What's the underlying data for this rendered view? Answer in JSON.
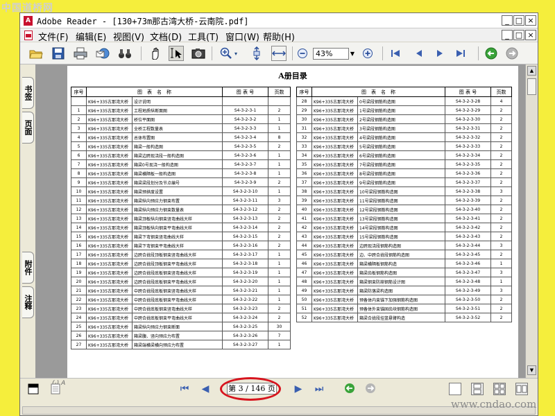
{
  "watermark": {
    "logo": "中国道桥网",
    "url": "www.cndao.com"
  },
  "window": {
    "title": "Adobe Reader - [130+73m那古湾大桥-云南院.pdf]",
    "app_icon": "adobe-reader-icon",
    "min": "_",
    "max": "□",
    "close": "×",
    "doc_min": "_",
    "doc_max": "□",
    "doc_close": "×"
  },
  "menu": [
    {
      "label": "文件(F)"
    },
    {
      "label": "编辑(E)"
    },
    {
      "label": "视图(V)"
    },
    {
      "label": "文档(D)"
    },
    {
      "label": "工具(T)"
    },
    {
      "label": "窗口(W)"
    },
    {
      "label": "帮助(H)"
    }
  ],
  "toolbar": {
    "zoom": "43%",
    "icons": [
      "open-folder-icon",
      "save-icon",
      "print-icon",
      "email-icon",
      "search-binoculars-icon",
      "hand-tool-icon",
      "select-text-icon",
      "snapshot-icon",
      "zoom-in-tool-icon",
      "fit-page-icon",
      "fit-width-icon",
      "zoom-out-icon",
      "zoom-in-icon",
      "first-page-icon",
      "prev-page-icon",
      "next-page-icon",
      "last-page-icon",
      "go-back-icon",
      "go-forward-icon"
    ]
  },
  "sidebar": {
    "tabs": [
      "书签",
      "页面",
      "附件",
      "注释"
    ]
  },
  "doc": {
    "title": "A册目录",
    "handnote": "(-) A",
    "headers": {
      "seq": "序号",
      "name": "图　表　名　称",
      "number": "图 表 号",
      "pages": "页数"
    },
    "left_rows": [
      [
        "",
        "K96+335古那湾大桥",
        "设计说明",
        "",
        ""
      ],
      [
        "1",
        "K96+335古那湾大桥",
        "工程地质纵断面图",
        "S4-3-2-3-1",
        "2"
      ],
      [
        "2",
        "K96+335古那湾大桥",
        "桥位平面图",
        "S4-3-2-3-2",
        "1"
      ],
      [
        "3",
        "K96+335古那湾大桥",
        "全桥工程数量表",
        "S4-3-2-3-3",
        "1"
      ],
      [
        "4",
        "K96+335古那湾大桥",
        "总体布置图",
        "S4-3-2-3-4",
        "8"
      ],
      [
        "5",
        "K96+335古那湾大桥",
        "箱梁一般构造图",
        "S4-3-2-3-5",
        "2"
      ],
      [
        "6",
        "K96+335古那湾大桥",
        "箱梁边跨现浇段一般构造图",
        "S4-3-2-3-6",
        "1"
      ],
      [
        "7",
        "K96+335古那湾大桥",
        "箱梁0号现浇一般构造图",
        "S4-3-2-3-7",
        "1"
      ],
      [
        "8",
        "K96+335古那湾大桥",
        "箱梁横隔板一般构造图",
        "S4-3-2-3-8",
        "1"
      ],
      [
        "9",
        "K96+335古那湾大桥",
        "箱梁梁段划分及节点编号",
        "S4-3-2-3-9",
        "2"
      ],
      [
        "10",
        "K96+335古那湾大桥",
        "箱梁预拱度设置",
        "S4-3-2-3-10",
        "1"
      ],
      [
        "11",
        "K96+335古那湾大桥",
        "箱梁纵向预应力钢束布置",
        "S4-3-2-3-11",
        "3"
      ],
      [
        "12",
        "K96+335古那湾大桥",
        "箱梁纵向预应力钢束数量表",
        "S4-3-2-3-12",
        "2"
      ],
      [
        "13",
        "K96+335古那湾大桥",
        "箱梁顶板纵向钢束竖弯曲线大样",
        "S4-3-2-3-13",
        "2"
      ],
      [
        "14",
        "K96+335古那湾大桥",
        "箱梁顶板纵向钢束平弯曲线大样",
        "S4-3-2-3-14",
        "2"
      ],
      [
        "15",
        "K96+335古那湾大桥",
        "箱梁下弯钢束竖弯曲线大样",
        "S4-3-2-3-15",
        "2"
      ],
      [
        "16",
        "K96+335古那湾大桥",
        "箱梁下弯钢束平弯曲线大样",
        "S4-3-2-3-16",
        "2"
      ],
      [
        "17",
        "K96+335古那湾大桥",
        "边跨合拢段顶板钢束竖弯曲线大样",
        "S4-3-2-3-17",
        "1"
      ],
      [
        "18",
        "K96+335古那湾大桥",
        "边跨合拢段顶板钢束平弯曲线大样",
        "S4-3-2-3-18",
        "1"
      ],
      [
        "19",
        "K96+335古那湾大桥",
        "边跨合拢段底板钢束竖弯曲线大样",
        "S4-3-2-3-19",
        "1"
      ],
      [
        "20",
        "K96+335古那湾大桥",
        "边跨合拢段底板钢束平弯曲线大样",
        "S4-3-2-3-20",
        "1"
      ],
      [
        "21",
        "K96+335古那湾大桥",
        "中跨合拢段底板钢束竖弯曲线大样",
        "S4-3-2-3-21",
        "1"
      ],
      [
        "22",
        "K96+335古那湾大桥",
        "中跨合拢段底板钢束平弯曲线大样",
        "S4-3-2-3-22",
        "1"
      ],
      [
        "23",
        "K96+335古那湾大桥",
        "中跨合拢底板钢束竖弯曲线大样",
        "S4-3-2-3-23",
        "2"
      ],
      [
        "24",
        "K96+335古那湾大桥",
        "中跨合拢底板钢束平弯曲线大样",
        "S4-3-2-3-24",
        "2"
      ],
      [
        "25",
        "K96+335古那湾大桥",
        "箱梁纵向预应力钢束断面",
        "S4-3-2-3-25",
        "30"
      ],
      [
        "26",
        "K96+335古那湾大桥",
        "箱梁腹、竖向预应力布置",
        "S4-3-2-3-26",
        "7"
      ],
      [
        "27",
        "K96+335古那湾大桥",
        "箱梁端横梁横向预应力布置",
        "S4-3-2-3-27",
        "1"
      ]
    ],
    "right_rows": [
      [
        "28",
        "K96+335古那湾大桥",
        "0号梁段钢筋构造图",
        "S4-3-2-3-28",
        "4"
      ],
      [
        "29",
        "K96+335古那湾大桥",
        "1号梁段钢筋构造图",
        "S4-3-2-3-29",
        "2"
      ],
      [
        "30",
        "K96+335古那湾大桥",
        "2号梁段钢筋构造图",
        "S4-3-2-3-30",
        "2"
      ],
      [
        "31",
        "K96+335古那湾大桥",
        "3号梁段钢筋构造图",
        "S4-3-2-3-31",
        "2"
      ],
      [
        "32",
        "K96+335古那湾大桥",
        "4号梁段钢筋构造图",
        "S4-3-2-3-32",
        "2"
      ],
      [
        "33",
        "K96+335古那湾大桥",
        "5号梁段钢筋构造图",
        "S4-3-2-3-33",
        "2"
      ],
      [
        "34",
        "K96+335古那湾大桥",
        "6号梁段钢筋构造图",
        "S4-3-2-3-34",
        "2"
      ],
      [
        "35",
        "K96+335古那湾大桥",
        "7号梁段钢筋构造图",
        "S4-3-2-3-35",
        "2"
      ],
      [
        "36",
        "K96+335古那湾大桥",
        "8号梁段钢筋构造图",
        "S4-3-2-3-36",
        "2"
      ],
      [
        "37",
        "K96+335古那湾大桥",
        "9号梁段钢筋构造图",
        "S4-3-2-3-37",
        "2"
      ],
      [
        "38",
        "K96+335古那湾大桥",
        "10号梁段钢筋构造图",
        "S4-3-2-3-38",
        "3"
      ],
      [
        "39",
        "K96+335古那湾大桥",
        "11号梁段钢筋构造图",
        "S4-3-2-3-39",
        "2"
      ],
      [
        "40",
        "K96+335古那湾大桥",
        "12号梁段钢筋构造图",
        "S4-3-2-3-40",
        "2"
      ],
      [
        "41",
        "K96+335古那湾大桥",
        "13号梁段钢筋构造图",
        "S4-3-2-3-41",
        "2"
      ],
      [
        "42",
        "K96+335古那湾大桥",
        "14号梁段钢筋构造图",
        "S4-3-2-3-42",
        "2"
      ],
      [
        "43",
        "K96+335古那湾大桥",
        "15号梁段钢筋构造图",
        "S4-3-2-3-43",
        "2"
      ],
      [
        "44",
        "K96+335古那湾大桥",
        "边跨现浇段钢筋构造图",
        "S4-3-2-3-44",
        "3"
      ],
      [
        "45",
        "K96+335古那湾大桥",
        "边、中跨合拢段钢筋构造图",
        "S4-3-2-3-45",
        "2"
      ],
      [
        "46",
        "K96+335古那湾大桥",
        "箱梁横隔板钢筋构造",
        "S4-3-2-3-46",
        "1"
      ],
      [
        "47",
        "K96+335古那湾大桥",
        "箱梁齿板钢筋构造图",
        "S4-3-2-3-47",
        "3"
      ],
      [
        "48",
        "K96+335古那湾大桥",
        "箱梁钢束防崩钢筋设计图",
        "S4-3-2-3-48",
        "1"
      ],
      [
        "49",
        "K96+335古那湾大桥",
        "箱梁防落梁构造图",
        "S4-3-2-3-49",
        "3"
      ],
      [
        "50",
        "K96+335古那湾大桥",
        "预备体内束锚下加强钢筋构造图",
        "S4-3-2-3-50",
        "2"
      ],
      [
        "51",
        "K96+335古那湾大桥",
        "预备体外束锚固齿块钢筋构造图",
        "S4-3-2-3-51",
        "2"
      ],
      [
        "52",
        "K96+335古那湾大桥",
        "箱梁合拢段挂篮悬臂构造",
        "S4-3-2-3-52",
        "2"
      ]
    ]
  },
  "status": {
    "page": "第 3 / 146 页"
  }
}
